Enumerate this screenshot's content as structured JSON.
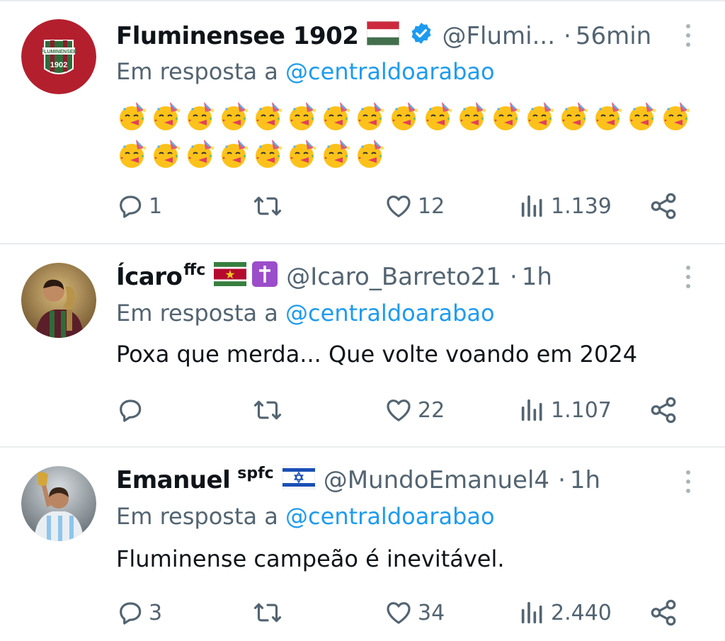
{
  "tweets": [
    {
      "name": "Fluminensee 1902",
      "handle": "@Flumi...",
      "time": "56min",
      "reply_prefix": "Em resposta a",
      "reply_to": "@centraldoarabao",
      "emoji_count_row1": 17,
      "emoji_count_row2": 8,
      "emoji_name": "partying-face",
      "replies": "1",
      "retweets": "",
      "likes": "12",
      "views": "1.139",
      "avatar_text_top": "FLUMINENSEE",
      "avatar_text_bottom": "1902"
    },
    {
      "name": "Ícaro",
      "name_sup": "ffc",
      "handle": "@Icaro_Barreto21",
      "time": "1h",
      "reply_prefix": "Em resposta a",
      "reply_to": "@centraldoarabao",
      "text": "Poxa que merda... Que volte voando em 2024",
      "replies": "",
      "retweets": "",
      "likes": "22",
      "views": "1.107"
    },
    {
      "name": "Emanuel",
      "name_sup": "spfc",
      "handle": "@MundoEmanuel4",
      "time": "1h",
      "reply_prefix": "Em resposta a",
      "reply_to": "@centraldoarabao",
      "text": "Fluminense campeão é inevitável.",
      "replies": "3",
      "retweets": "",
      "likes": "34",
      "views": "2.440"
    }
  ],
  "separator": "·",
  "colors": {
    "muted": "#536471",
    "link": "#1d9bf0",
    "verified": "#1d9bf0",
    "text": "#0f1419"
  },
  "icons": [
    "reply-icon",
    "retweet-icon",
    "like-icon",
    "views-icon",
    "share-icon",
    "more-icon",
    "verified-icon"
  ]
}
